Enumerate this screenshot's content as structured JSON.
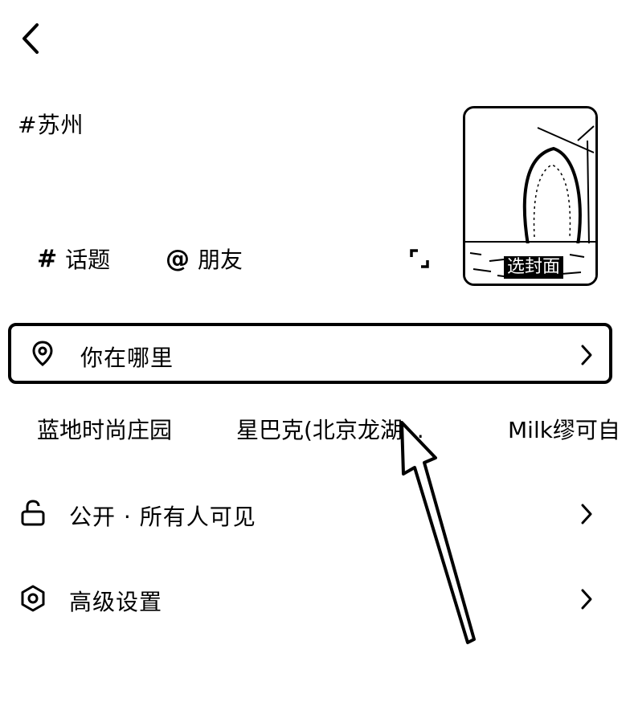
{
  "post_caption": "#苏州",
  "cover": {
    "label": "选封面"
  },
  "chips": {
    "topic_symbol": "#",
    "topic_label": "话题",
    "friend_symbol": "@",
    "friend_label": "朋友"
  },
  "location": {
    "placeholder": "你在哪里",
    "suggestions": [
      "蓝地时尚庄园",
      "星巴克(北京龙湖...",
      "Milk缪可自"
    ]
  },
  "visibility": {
    "label": "公开 · 所有人可见"
  },
  "advanced": {
    "label": "高级设置"
  },
  "icons": {
    "back": "back-chevron-icon",
    "expand": "expand-icon",
    "location": "location-pin-icon",
    "lock": "unlock-icon",
    "settings": "hexagon-settings-icon",
    "chevron": "chevron-right-icon"
  }
}
